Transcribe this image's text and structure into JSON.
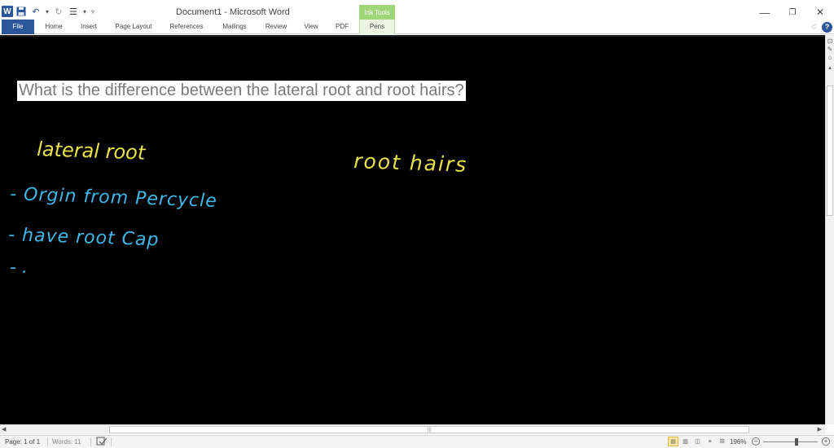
{
  "titlebar": {
    "document_title": "Document1  -  Microsoft Word",
    "contextual_group": "Ink Tools",
    "qat_icons": [
      "word-logo-icon",
      "save-icon",
      "undo-icon",
      "redo-icon",
      "bullets-icon",
      "customize-qat-icon"
    ],
    "minimize_glyph": "—",
    "restore_glyph": "❐",
    "close_glyph": "✕"
  },
  "ribbon": {
    "tabs": [
      {
        "label": "File"
      },
      {
        "label": "Home"
      },
      {
        "label": "Insert"
      },
      {
        "label": "Page Layout"
      },
      {
        "label": "References"
      },
      {
        "label": "Mailings"
      },
      {
        "label": "Review"
      },
      {
        "label": "View"
      },
      {
        "label": "PDF"
      },
      {
        "label": "Pens"
      }
    ],
    "help_glyph": "?",
    "minimize_ribbon_glyph": "♡"
  },
  "document": {
    "question": "What is the difference between the lateral root and root hairs?",
    "ink_color_heading": "#e8e34a",
    "ink_color_notes": "#3fb8e8",
    "ink": {
      "heading_left": "lateral root",
      "heading_right": "root hairs",
      "note_1": "- Orgin from Percycle",
      "note_2": "- have   root Cap",
      "note_3": "- ."
    }
  },
  "statusbar": {
    "page": "Page: 1 of 1",
    "words": "Words: 11",
    "zoom": "196%",
    "zoom_percent": 196
  }
}
